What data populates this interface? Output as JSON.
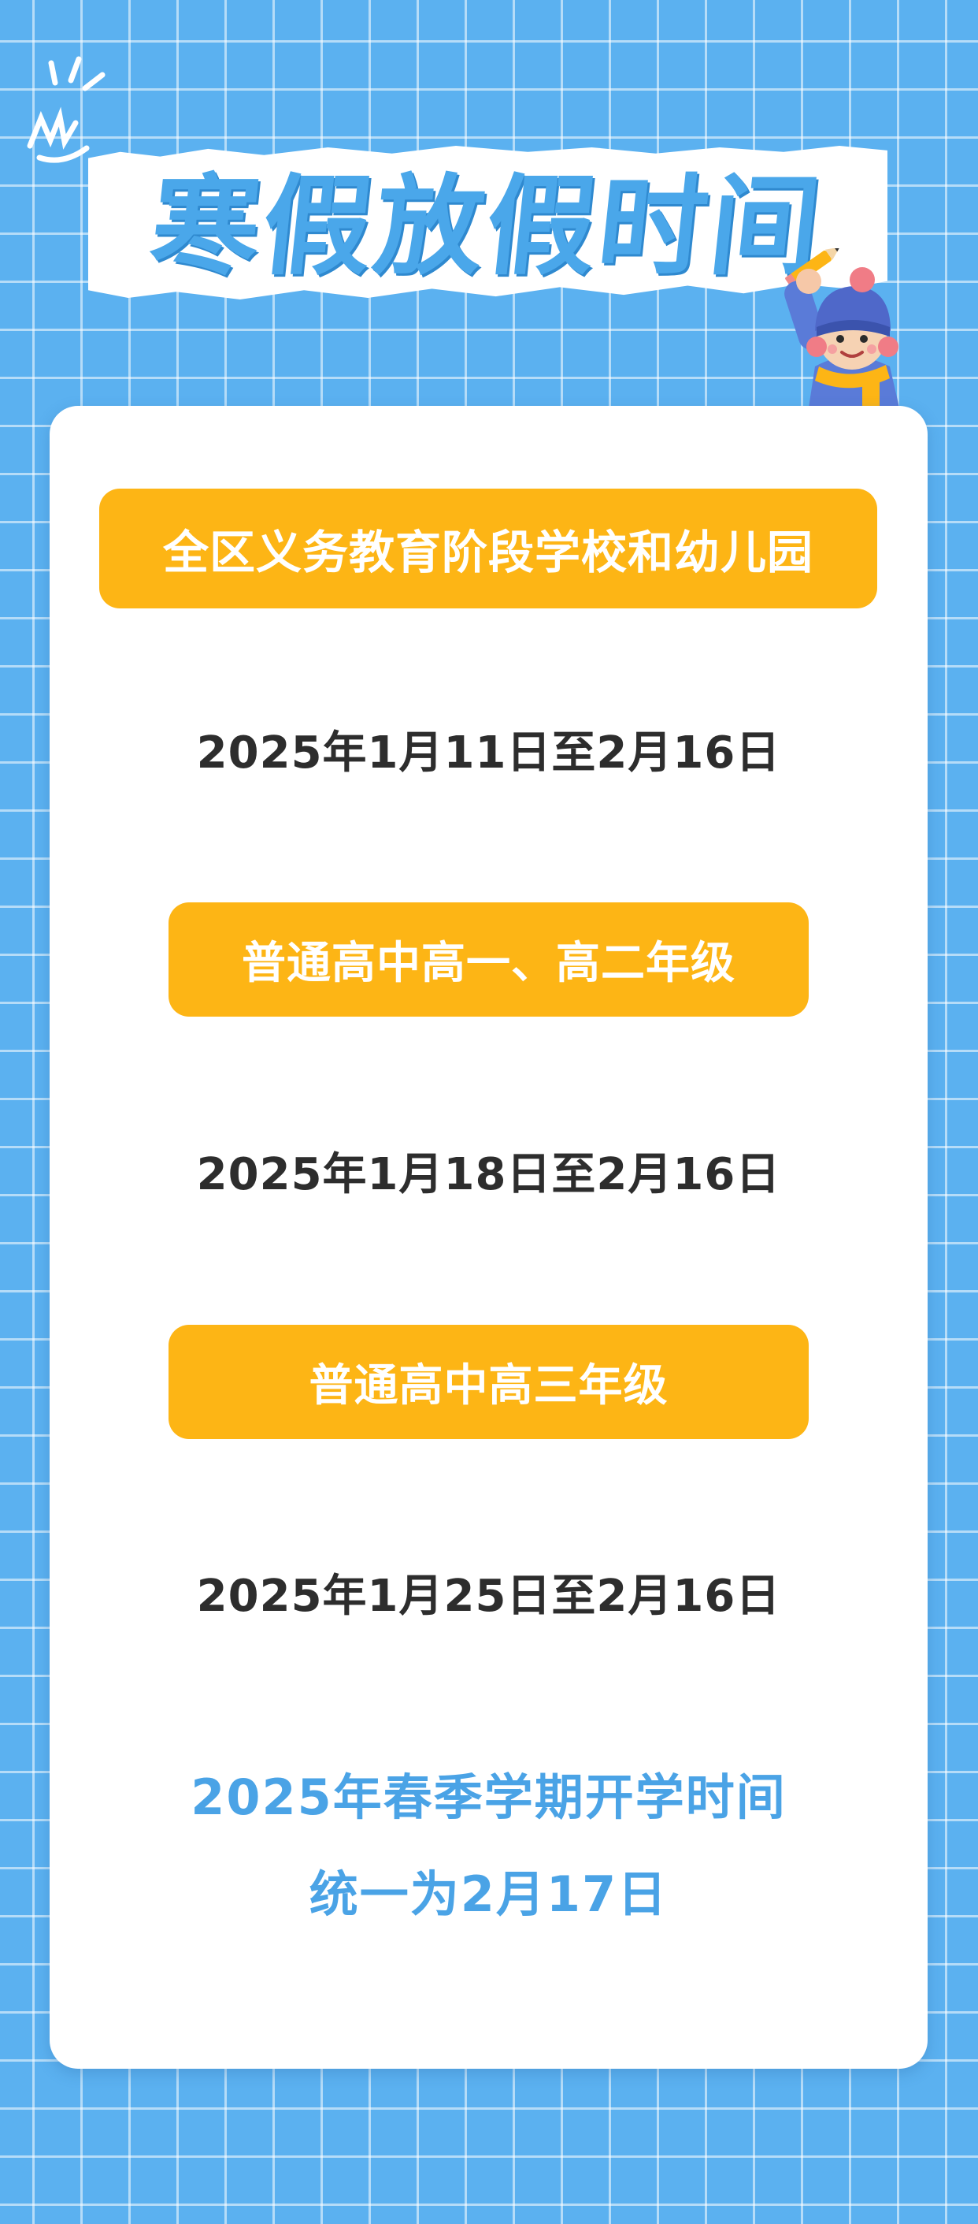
{
  "title": "寒假放假时间",
  "schedule": [
    {
      "label": "全区义务教育阶段学校和幼儿园",
      "dates": "2025年1月11日至2月16日"
    },
    {
      "label": "普通高中高一、高二年级",
      "dates": "2025年1月18日至2月16日"
    },
    {
      "label": "普通高中高三年级",
      "dates": "2025年1月25日至2月16日"
    }
  ],
  "note": {
    "line1": "2025年春季学期开学时间",
    "line2": "统一为2月17日"
  },
  "colors": {
    "background": "#5bb1f0",
    "title": "#4aa7ea",
    "pill": "#fdb515",
    "date_text": "#2d2d2d",
    "note_text": "#4aa3e6"
  },
  "icons": [
    "sparkle-icon",
    "kid-illustration"
  ]
}
